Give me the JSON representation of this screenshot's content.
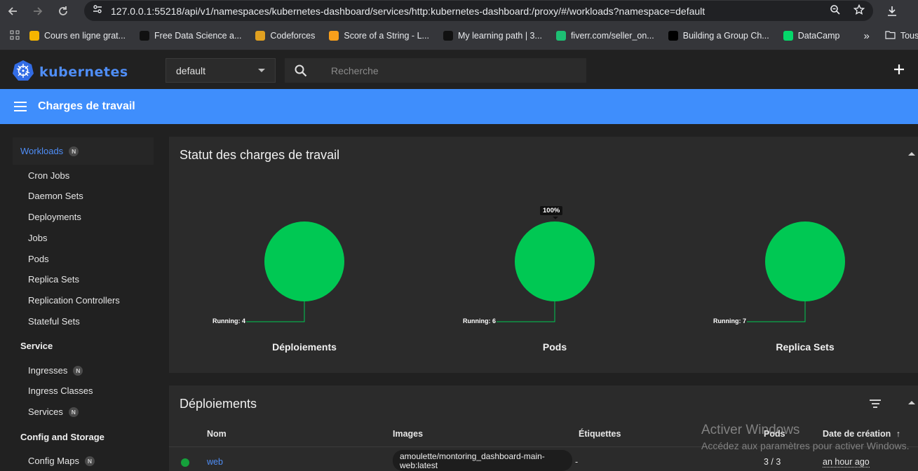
{
  "browser": {
    "url": "127.0.0.1:55218/api/v1/namespaces/kubernetes-dashboard/services/http:kubernetes-dashboard:/proxy/#/workloads?namespace=default",
    "bookmarks": [
      {
        "label": "Cours en ligne grat...",
        "color": "#f4b400"
      },
      {
        "label": "Free Data Science a...",
        "color": "#111111"
      },
      {
        "label": "Codeforces",
        "color": "#e0a020"
      },
      {
        "label": "Score of a String - L...",
        "color": "#f89f1b"
      },
      {
        "label": "My learning path | 3...",
        "color": "#111111"
      },
      {
        "label": "fiverr.com/seller_on...",
        "color": "#1dbf73"
      },
      {
        "label": "Building a Group Ch...",
        "color": "#000000"
      },
      {
        "label": "DataCamp",
        "color": "#05d76a"
      }
    ],
    "other_bookmarks": "Tous le"
  },
  "header": {
    "logo_text": "kubernetes",
    "namespace": "default",
    "search_placeholder": "Recherche"
  },
  "toolbar": {
    "title": "Charges de travail"
  },
  "sidebar": {
    "active": {
      "label": "Workloads",
      "badge": "N"
    },
    "workload_items": [
      "Cron Jobs",
      "Daemon Sets",
      "Deployments",
      "Jobs",
      "Pods",
      "Replica Sets",
      "Replication Controllers",
      "Stateful Sets"
    ],
    "service_heading": "Service",
    "service_items": [
      {
        "label": "Ingresses",
        "badge": "N"
      },
      {
        "label": "Ingress Classes",
        "badge": ""
      },
      {
        "label": "Services",
        "badge": "N"
      }
    ],
    "config_heading": "Config and Storage",
    "config_items": [
      {
        "label": "Config Maps",
        "badge": "N"
      }
    ]
  },
  "status_card": {
    "title": "Statut des charges de travail",
    "tooltip": "100%",
    "charts": [
      {
        "title": "Déploiements",
        "legend": "Running: 4",
        "running": 4,
        "color": "#00c853"
      },
      {
        "title": "Pods",
        "legend": "Running: 6",
        "running": 6,
        "color": "#00c853"
      },
      {
        "title": "Replica Sets",
        "legend": "Running: 7",
        "running": 7,
        "color": "#00c853"
      }
    ]
  },
  "deployments_card": {
    "title": "Déploiements",
    "columns": {
      "name": "Nom",
      "images": "Images",
      "labels": "Étiquettes",
      "pods": "Pods",
      "created": "Date de création"
    },
    "rows": [
      {
        "name": "web",
        "image": "amoulette/montoring_dashboard-main-web:latest",
        "labels": "-",
        "pods": "3 / 3",
        "created": "an hour ago"
      }
    ]
  },
  "watermark": {
    "title": "Activer Windows",
    "subtitle": "Accédez aux paramètres pour activer Windows."
  }
}
